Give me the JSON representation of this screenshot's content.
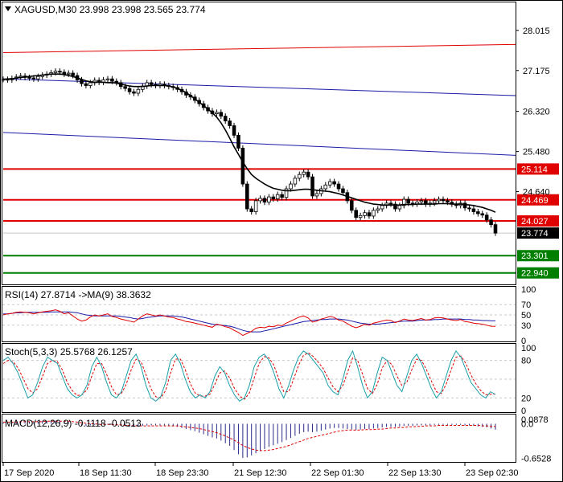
{
  "chart_data": {
    "type": "candlestick",
    "symbol_line": "XAGUSD,M30  23.998 23.998 23.565 23.774",
    "main": {
      "ylim": [
        22.7,
        28.6
      ],
      "ticks": [
        "28.015",
        "27.175",
        "26.320",
        "25.480",
        "24.640"
      ],
      "close_series": [
        26.99,
        26.98,
        27.01,
        27.04,
        27.06,
        27.03,
        27.02,
        27.0,
        27.05,
        27.08,
        27.1,
        27.13,
        27.16,
        27.14,
        27.1,
        27.12,
        27.07,
        26.98,
        26.9,
        26.86,
        26.92,
        26.97,
        26.93,
        26.98,
        27.0,
        26.95,
        26.92,
        26.84,
        26.8,
        26.73,
        26.7,
        26.78,
        26.85,
        26.92,
        26.88,
        26.86,
        26.89,
        26.86,
        26.84,
        26.82,
        26.78,
        26.73,
        26.66,
        26.62,
        26.55,
        26.48,
        26.4,
        26.33,
        26.27,
        26.3,
        26.22,
        26.12,
        26.02,
        25.82,
        25.55,
        24.8,
        24.28,
        24.22,
        24.45,
        24.5,
        24.42,
        24.53,
        24.49,
        24.58,
        24.52,
        24.7,
        24.8,
        24.92,
        25.0,
        25.05,
        24.95,
        24.55,
        24.6,
        24.7,
        24.78,
        24.85,
        24.8,
        24.7,
        24.62,
        24.45,
        24.25,
        24.1,
        24.14,
        24.2,
        24.13,
        24.25,
        24.28,
        24.35,
        24.4,
        24.38,
        24.28,
        24.35,
        24.48,
        24.4,
        24.38,
        24.42,
        24.45,
        24.38,
        24.4,
        24.45,
        24.48,
        24.45,
        24.42,
        24.38,
        24.35,
        24.4,
        24.3,
        24.28,
        24.22,
        24.18,
        24.15,
        24.05,
        23.95,
        23.774
      ],
      "ma_series": [
        26.99,
        27.0,
        27.0,
        27.02,
        27.03,
        27.04,
        27.05,
        27.06,
        27.07,
        27.08,
        27.09,
        27.1,
        27.1,
        27.1,
        27.09,
        27.07,
        27.05,
        27.02,
        26.99,
        26.96,
        26.94,
        26.93,
        26.93,
        26.93,
        26.92,
        26.92,
        26.91,
        26.89,
        26.87,
        26.85,
        26.84,
        26.84,
        26.84,
        26.85,
        26.86,
        26.86,
        26.86,
        26.86,
        26.85,
        26.83,
        26.8,
        26.76,
        26.71,
        26.65,
        26.58,
        26.51,
        26.44,
        26.37,
        26.29,
        26.2,
        26.08,
        25.93,
        25.76,
        25.58,
        25.42,
        25.26,
        25.12,
        25.0,
        24.92,
        24.86,
        24.8,
        24.75,
        24.71,
        24.69,
        24.67,
        24.66,
        24.66,
        24.67,
        24.68,
        24.69,
        24.69,
        24.68,
        24.67,
        24.66,
        24.65,
        24.64,
        24.62,
        24.6,
        24.57,
        24.54,
        24.51,
        24.48,
        24.45,
        24.42,
        24.4,
        24.38,
        24.37,
        24.36,
        24.36,
        24.36,
        24.36,
        24.36,
        24.37,
        24.37,
        24.37,
        24.38,
        24.38,
        24.38,
        24.38,
        24.38,
        24.39,
        24.39,
        24.39,
        24.38,
        24.38,
        24.38,
        24.37,
        24.36,
        24.35,
        24.33,
        24.31,
        24.28,
        24.25,
        24.21
      ],
      "upper_channel": {
        "from": 27.0,
        "to": 26.65
      },
      "lower_channel": {
        "from": 25.88,
        "to": 25.4
      },
      "top_line": {
        "from": 27.55,
        "to": 27.72
      },
      "levels_red": [
        {
          "value": 25.114,
          "label": "25.114"
        },
        {
          "value": 24.469,
          "label": "24.469"
        },
        {
          "value": 24.027,
          "label": "24.027"
        }
      ],
      "levels_green": [
        {
          "value": 23.301,
          "label": "23.301"
        },
        {
          "value": 22.94,
          "label": "22.940"
        }
      ],
      "current": {
        "value": 23.774,
        "label": "23.774"
      }
    },
    "rsi": {
      "label": "RSI(14) 27.8714  ->MA(9) 38.3632",
      "ylim": [
        0,
        100
      ],
      "ticks": [
        "100",
        "70",
        "50",
        "30",
        "0"
      ],
      "levels": [
        70,
        50,
        30
      ],
      "values": [
        50,
        52,
        53,
        55,
        56,
        55,
        54,
        52,
        54,
        56,
        57,
        58,
        60,
        57,
        52,
        54,
        48,
        42,
        38,
        40,
        46,
        50,
        48,
        50,
        52,
        47,
        45,
        42,
        40,
        38,
        36,
        42,
        48,
        52,
        50,
        48,
        50,
        48,
        46,
        45,
        42,
        40,
        37,
        36,
        34,
        32,
        30,
        28,
        26,
        32,
        30,
        27,
        25,
        20,
        16,
        10,
        14,
        18,
        24,
        26,
        25,
        28,
        27,
        30,
        29,
        34,
        38,
        42,
        46,
        48,
        44,
        36,
        38,
        42,
        44,
        47,
        45,
        40,
        38,
        33,
        28,
        25,
        28,
        32,
        30,
        34,
        36,
        38,
        40,
        39,
        35,
        38,
        42,
        40,
        39,
        41,
        43,
        40,
        41,
        44,
        45,
        44,
        42,
        40,
        39,
        41,
        37,
        36,
        34,
        33,
        32,
        30,
        28,
        27.87
      ],
      "ma_values": [
        52,
        52,
        53,
        54,
        54,
        55,
        55,
        55,
        55,
        55,
        55,
        56,
        56,
        56,
        56,
        56,
        55,
        54,
        52,
        50,
        49,
        48,
        48,
        48,
        48,
        48,
        48,
        47,
        46,
        45,
        43,
        42,
        43,
        45,
        46,
        47,
        48,
        48,
        48,
        48,
        47,
        46,
        44,
        42,
        40,
        38,
        36,
        34,
        32,
        31,
        30,
        29,
        28,
        26,
        23,
        20,
        18,
        17,
        17,
        17,
        19,
        21,
        23,
        25,
        27,
        29,
        31,
        33,
        35,
        37,
        38,
        39,
        40,
        41,
        41,
        42,
        42,
        42,
        41,
        40,
        38,
        36,
        34,
        33,
        32,
        32,
        32,
        33,
        34,
        35,
        36,
        37,
        38,
        38,
        38,
        39,
        40,
        40,
        40,
        41,
        41,
        42,
        42,
        42,
        42,
        42,
        41,
        41,
        40,
        40,
        39,
        39,
        38.5,
        38.36
      ]
    },
    "stoch": {
      "label": "Stoch(5,3,3) 25.5768 26.1257",
      "ylim": [
        0,
        100
      ],
      "ticks": [
        "100",
        "80",
        "20",
        "0"
      ],
      "levels": [
        80,
        50,
        20
      ],
      "main_values": [
        80,
        85,
        75,
        60,
        40,
        20,
        25,
        45,
        70,
        85,
        80,
        75,
        55,
        35,
        25,
        20,
        25,
        40,
        70,
        85,
        70,
        45,
        25,
        20,
        30,
        55,
        80,
        90,
        70,
        40,
        20,
        15,
        22,
        45,
        80,
        90,
        75,
        50,
        30,
        20,
        25,
        20,
        30,
        55,
        70,
        60,
        40,
        25,
        15,
        20,
        40,
        70,
        85,
        90,
        80,
        60,
        35,
        20,
        40,
        65,
        85,
        95,
        90,
        80,
        70,
        60,
        40,
        30,
        25,
        50,
        80,
        95,
        70,
        40,
        20,
        30,
        60,
        85,
        80,
        60,
        40,
        30,
        55,
        80,
        90,
        75,
        55,
        35,
        20,
        30,
        55,
        80,
        95,
        85,
        65,
        45,
        35,
        25,
        20,
        30,
        25.58
      ],
      "signal_values": [
        75,
        80,
        78,
        68,
        52,
        35,
        28,
        35,
        55,
        75,
        80,
        78,
        65,
        45,
        32,
        24,
        25,
        33,
        55,
        75,
        75,
        58,
        38,
        25,
        27,
        42,
        65,
        82,
        78,
        57,
        35,
        22,
        20,
        32,
        60,
        82,
        82,
        65,
        43,
        28,
        23,
        23,
        26,
        42,
        60,
        63,
        52,
        35,
        23,
        18,
        28,
        52,
        75,
        86,
        84,
        72,
        50,
        30,
        30,
        50,
        72,
        88,
        92,
        86,
        77,
        67,
        52,
        38,
        30,
        40,
        62,
        84,
        80,
        58,
        35,
        27,
        42,
        68,
        80,
        73,
        55,
        40,
        45,
        65,
        82,
        80,
        65,
        47,
        30,
        27,
        42,
        65,
        85,
        87,
        75,
        57,
        43,
        32,
        25,
        26,
        26.13
      ]
    },
    "macd": {
      "label": "MACD(12,26,9) -0.1118 -0.0513",
      "ylim": [
        -0.71,
        0.13
      ],
      "ticks": [
        "0.0878",
        "0.0",
        "-0.6528"
      ],
      "hist": [
        0.02,
        0.03,
        0.03,
        0.04,
        0.04,
        0.04,
        0.04,
        0.03,
        0.04,
        0.05,
        0.05,
        0.06,
        0.06,
        0.05,
        0.04,
        0.03,
        0.01,
        -0.01,
        -0.03,
        -0.04,
        -0.03,
        -0.02,
        -0.02,
        -0.01,
        -0.01,
        -0.02,
        -0.03,
        -0.04,
        -0.05,
        -0.06,
        -0.06,
        -0.05,
        -0.04,
        -0.03,
        -0.03,
        -0.03,
        -0.03,
        -0.03,
        -0.04,
        -0.05,
        -0.06,
        -0.08,
        -0.1,
        -0.12,
        -0.14,
        -0.17,
        -0.2,
        -0.23,
        -0.26,
        -0.28,
        -0.32,
        -0.37,
        -0.42,
        -0.5,
        -0.58,
        -0.65,
        -0.64,
        -0.6,
        -0.56,
        -0.52,
        -0.48,
        -0.44,
        -0.41,
        -0.38,
        -0.35,
        -0.31,
        -0.27,
        -0.23,
        -0.19,
        -0.16,
        -0.15,
        -0.16,
        -0.15,
        -0.13,
        -0.11,
        -0.09,
        -0.08,
        -0.08,
        -0.09,
        -0.1,
        -0.11,
        -0.12,
        -0.11,
        -0.1,
        -0.1,
        -0.09,
        -0.08,
        -0.07,
        -0.06,
        -0.06,
        -0.06,
        -0.05,
        -0.04,
        -0.04,
        -0.04,
        -0.03,
        -0.03,
        -0.03,
        -0.03,
        -0.02,
        -0.02,
        -0.02,
        -0.02,
        -0.02,
        -0.02,
        -0.02,
        -0.03,
        -0.03,
        -0.04,
        -0.05,
        -0.06,
        -0.07,
        -0.09,
        -0.1118
      ],
      "signal": [
        0.03,
        0.03,
        0.03,
        0.03,
        0.04,
        0.04,
        0.04,
        0.04,
        0.04,
        0.04,
        0.05,
        0.05,
        0.05,
        0.05,
        0.05,
        0.05,
        0.04,
        0.03,
        0.02,
        0.01,
        0.0,
        0.0,
        -0.01,
        -0.01,
        -0.01,
        -0.01,
        -0.02,
        -0.02,
        -0.03,
        -0.03,
        -0.04,
        -0.04,
        -0.04,
        -0.04,
        -0.04,
        -0.04,
        -0.04,
        -0.04,
        -0.04,
        -0.04,
        -0.04,
        -0.05,
        -0.06,
        -0.07,
        -0.08,
        -0.09,
        -0.11,
        -0.13,
        -0.15,
        -0.17,
        -0.2,
        -0.23,
        -0.27,
        -0.31,
        -0.36,
        -0.41,
        -0.45,
        -0.48,
        -0.5,
        -0.51,
        -0.51,
        -0.5,
        -0.49,
        -0.47,
        -0.45,
        -0.43,
        -0.4,
        -0.37,
        -0.34,
        -0.31,
        -0.28,
        -0.26,
        -0.24,
        -0.22,
        -0.2,
        -0.18,
        -0.16,
        -0.14,
        -0.13,
        -0.12,
        -0.12,
        -0.12,
        -0.12,
        -0.11,
        -0.11,
        -0.11,
        -0.1,
        -0.1,
        -0.09,
        -0.08,
        -0.08,
        -0.07,
        -0.07,
        -0.06,
        -0.06,
        -0.05,
        -0.05,
        -0.04,
        -0.04,
        -0.04,
        -0.03,
        -0.03,
        -0.03,
        -0.03,
        -0.03,
        -0.03,
        -0.03,
        -0.03,
        -0.03,
        -0.03,
        -0.04,
        -0.04,
        -0.05,
        -0.0513
      ]
    },
    "time_labels": [
      "17 Sep 2020",
      "18 Sep 11:30",
      "18 Sep 23:30",
      "21 Sep 12:30",
      "22 Sep 01:30",
      "22 Sep 13:30",
      "23 Sep 02:30"
    ],
    "colors": {
      "red": "#e00000",
      "green": "#007f00",
      "blue": "#1a1aa8",
      "macd_bar": "#2a2a8c",
      "dark": "#000000",
      "grid": "#c8c8c8"
    }
  }
}
